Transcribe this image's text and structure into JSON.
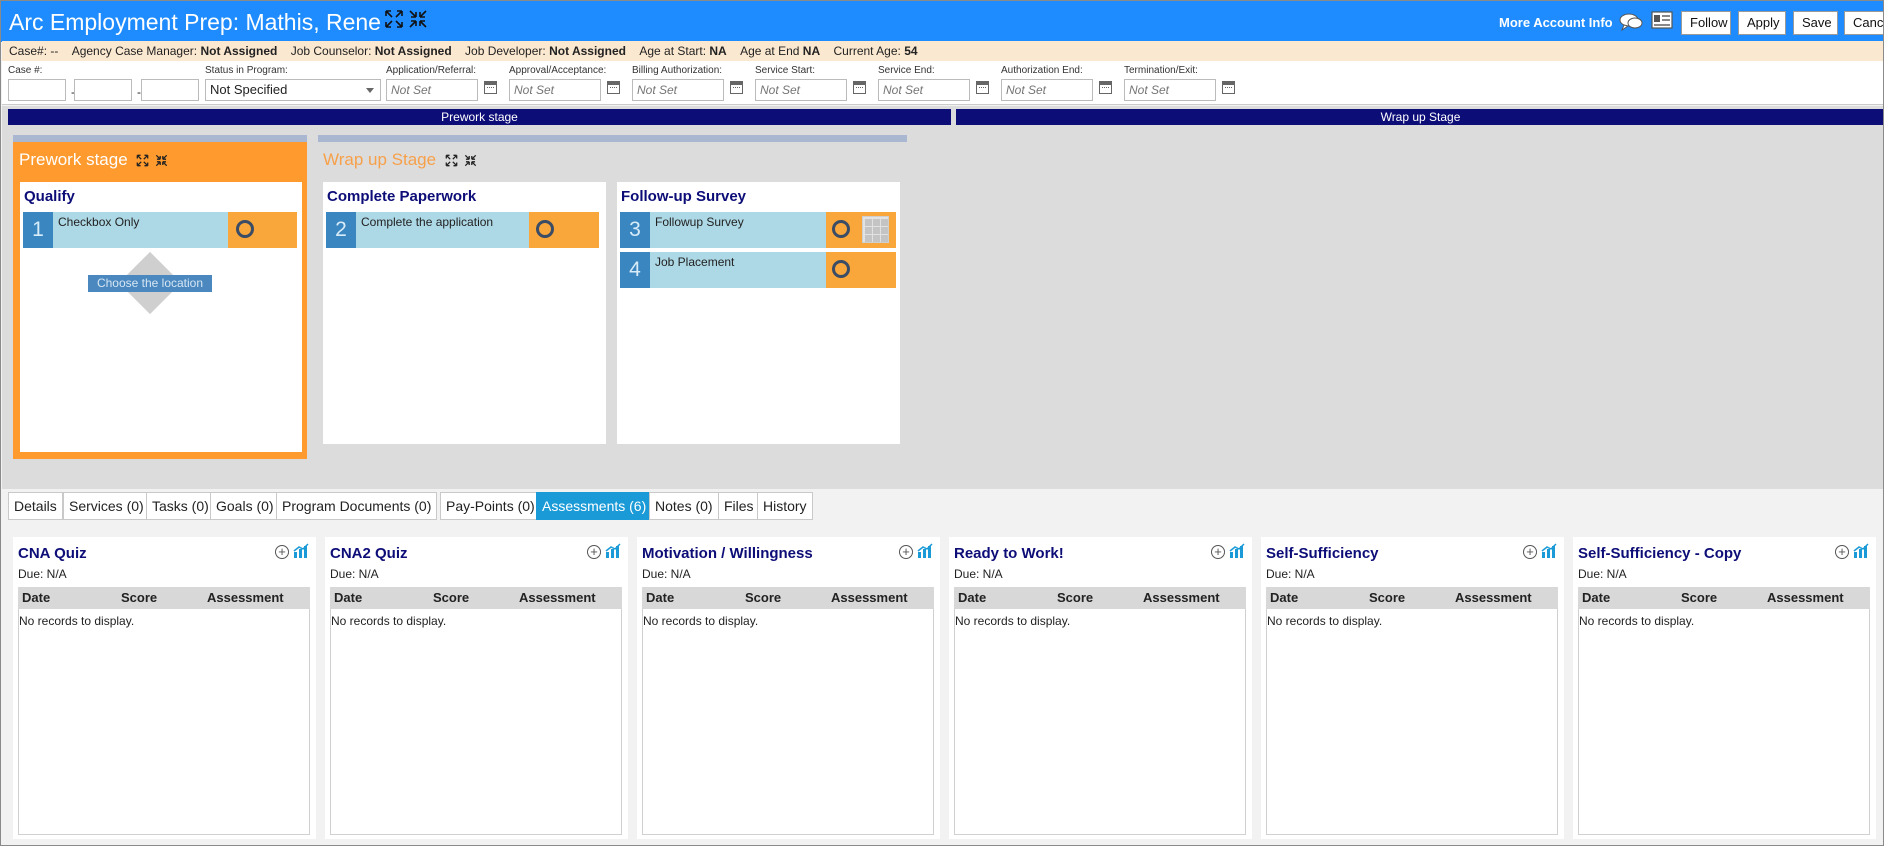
{
  "header": {
    "title": "Arc Employment Prep: Mathis, Rene",
    "more_info": "More Account Info",
    "buttons": {
      "follow": "Follow",
      "apply": "Apply",
      "save": "Save",
      "cancel": "Cancel"
    },
    "bg_color": "#1e8cff"
  },
  "info": {
    "case_label": "Case#: --",
    "agency_label": "Agency Case Manager:",
    "agency_value": "Not Assigned",
    "counselor_label": "Job Counselor:",
    "counselor_value": "Not Assigned",
    "developer_label": "Job Developer:",
    "developer_value": "Not Assigned",
    "age_start_label": "Age at Start:",
    "age_start_value": "NA",
    "age_end_label": "Age at End",
    "age_end_value": "NA",
    "current_age_label": "Current Age:",
    "current_age_value": "54"
  },
  "fields": {
    "case_num_label": "Case #:",
    "status_label": "Status in Program:",
    "status_value": "Not Specified",
    "dates": [
      {
        "label": "Application/Referral:",
        "placeholder": "Not Set"
      },
      {
        "label": "Approval/Acceptance:",
        "placeholder": "Not Set"
      },
      {
        "label": "Billing Authorization:",
        "placeholder": "Not Set"
      },
      {
        "label": "Service Start:",
        "placeholder": "Not Set"
      },
      {
        "label": "Service End:",
        "placeholder": "Not Set"
      },
      {
        "label": "Authorization End:",
        "placeholder": "Not Set"
      },
      {
        "label": "Termination/Exit:",
        "placeholder": "Not Set"
      }
    ]
  },
  "stagebars": {
    "prework": "Prework stage",
    "wrapup": "Wrap up Stage"
  },
  "stages": {
    "prework": {
      "title": "Prework stage",
      "columns": [
        {
          "title": "Qualify",
          "tasks": [
            {
              "num": "1",
              "name": "Checkbox Only"
            }
          ],
          "drop_label": "Choose the location"
        }
      ]
    },
    "wrapup": {
      "title": "Wrap up Stage",
      "columns": [
        {
          "title": "Complete Paperwork",
          "tasks": [
            {
              "num": "2",
              "name": "Complete the application"
            }
          ]
        },
        {
          "title": "Follow-up Survey",
          "tasks": [
            {
              "num": "3",
              "name": "Followup Survey"
            },
            {
              "num": "4",
              "name": "Job Placement"
            }
          ]
        }
      ]
    }
  },
  "tabs": [
    "Details",
    "Services (0)",
    "Tasks (0)",
    "Goals (0)",
    "Program Documents (0)",
    "Pay-Points (0)",
    "Assessments (6)",
    "Notes (0)",
    "Files",
    "History"
  ],
  "active_tab": "Assessments (6)",
  "assessments": {
    "due": "Due: N/A",
    "headers": {
      "date": "Date",
      "score": "Score",
      "assessment": "Assessment"
    },
    "empty": "No records to display.",
    "items": [
      "CNA Quiz",
      "CNA2 Quiz",
      "Motivation / Willingness",
      "Ready to Work!",
      "Self-Sufficiency",
      "Self-Sufficiency - Copy"
    ]
  }
}
